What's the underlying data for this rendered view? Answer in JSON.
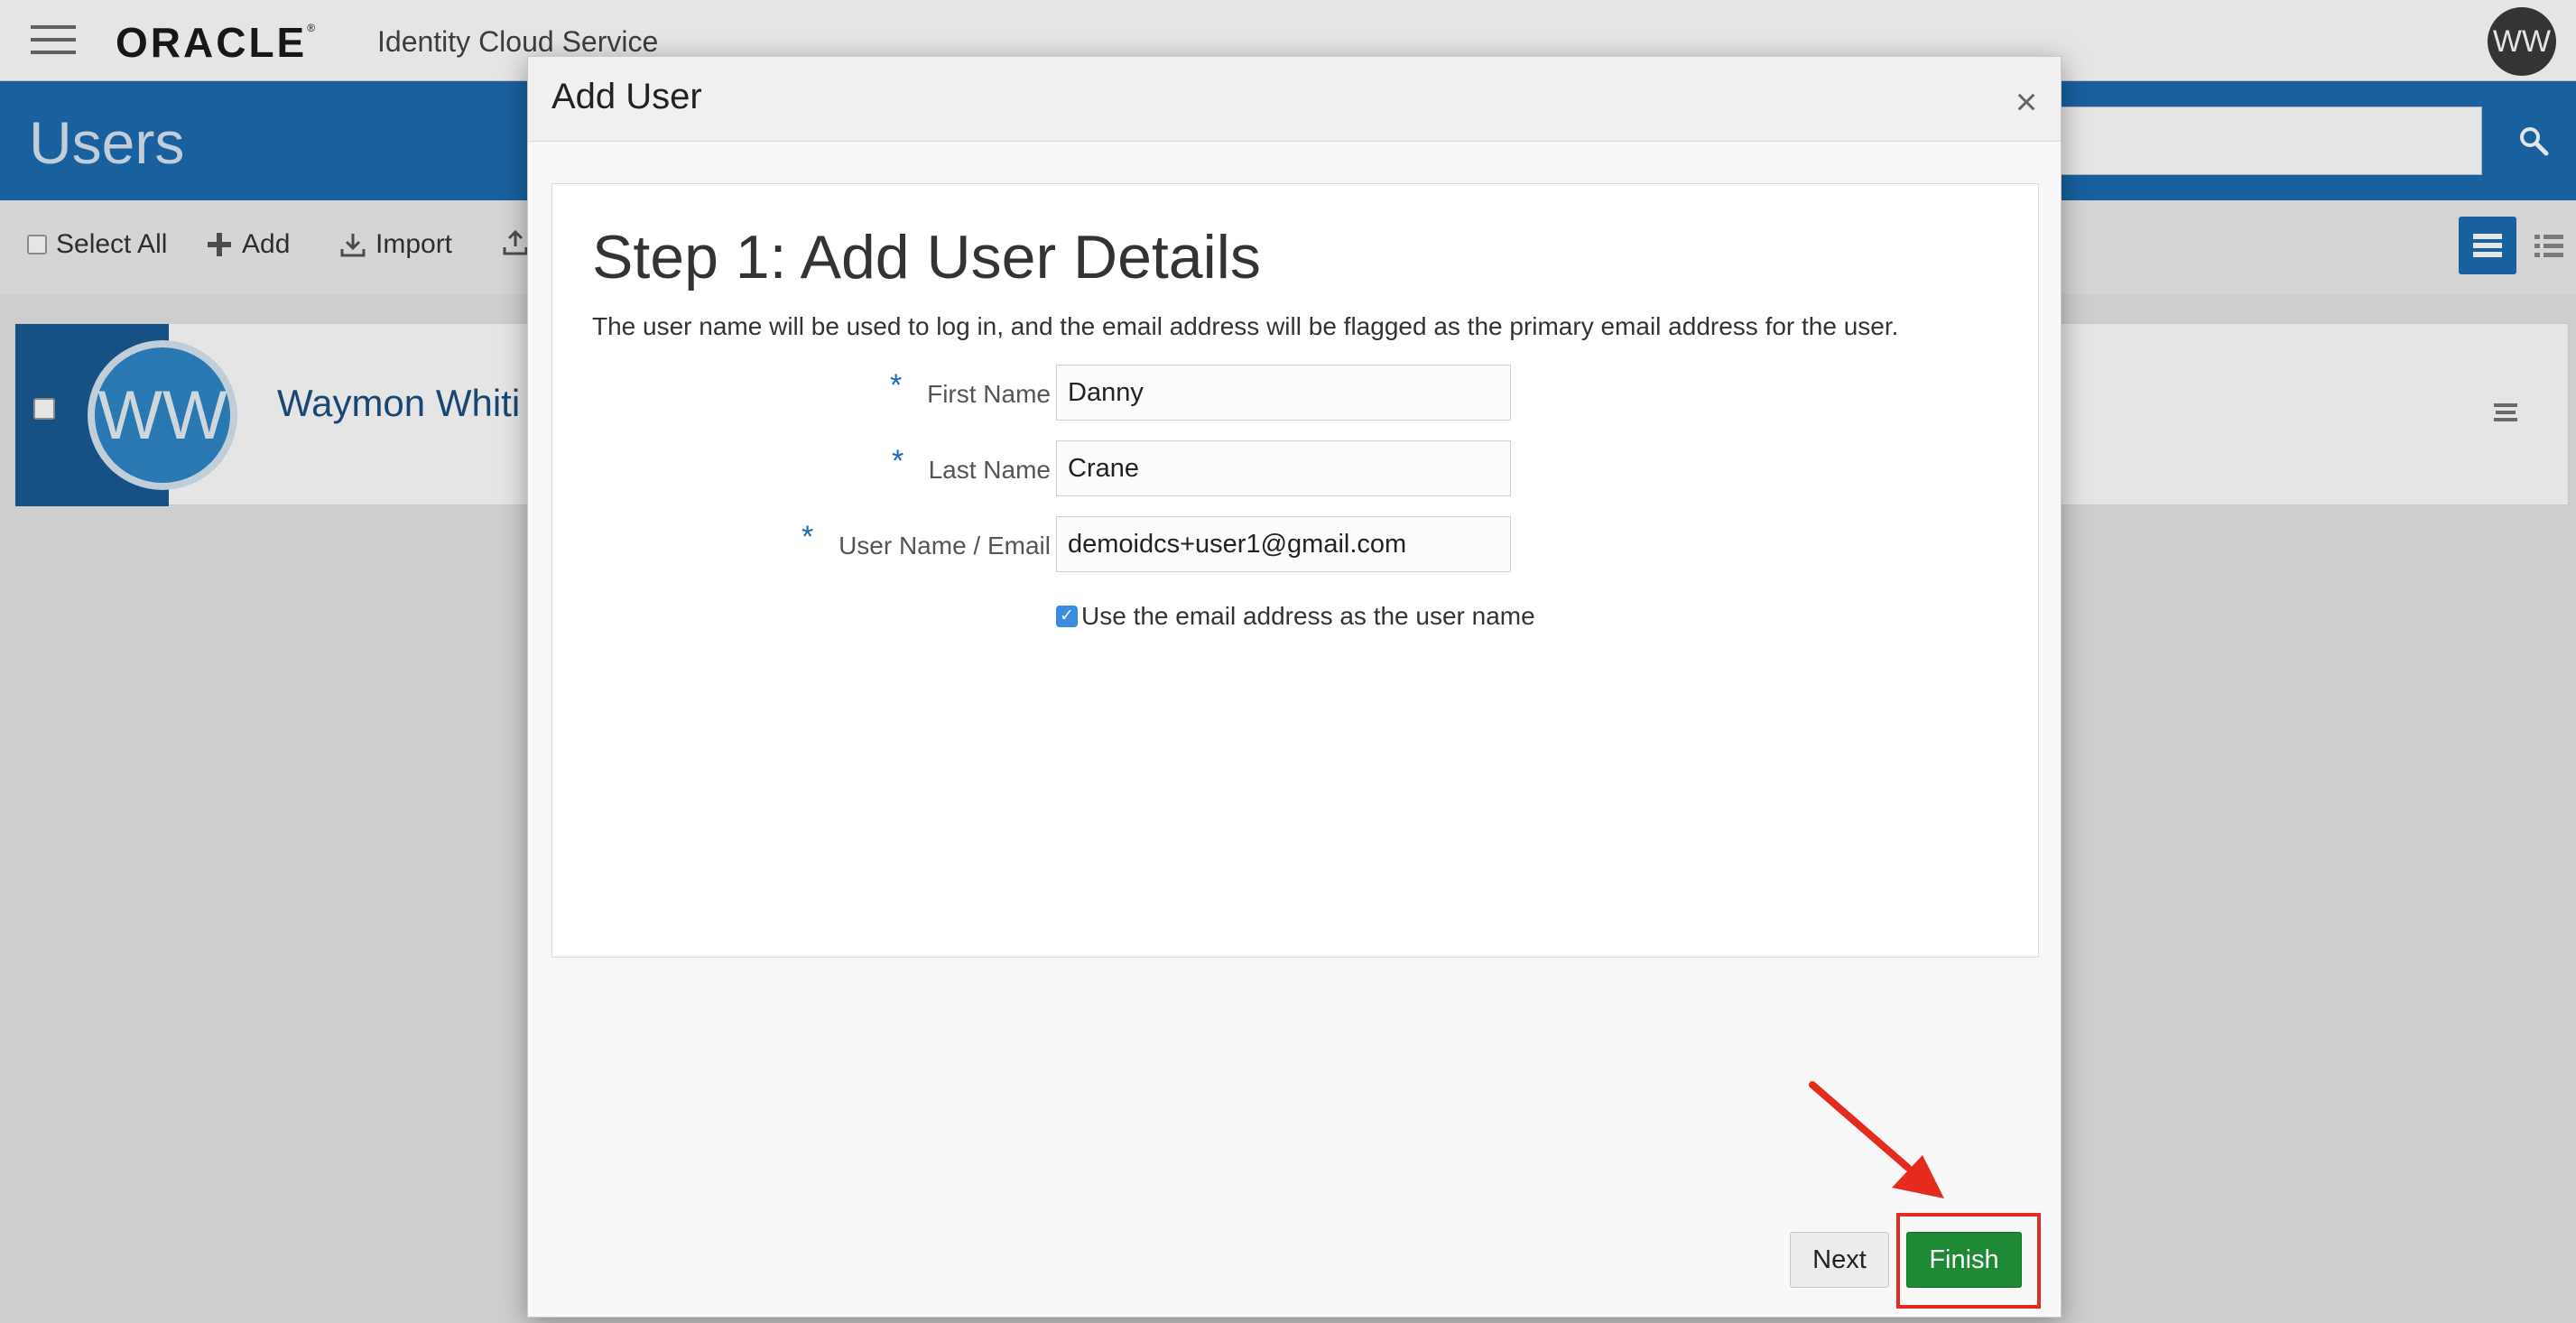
{
  "topbar": {
    "brand": "ORACLE",
    "brand_mark": "®",
    "product": "Identity Cloud Service",
    "avatar_initials": "WW"
  },
  "page": {
    "title": "Users"
  },
  "toolbar": {
    "select_all": "Select All",
    "add": "Add",
    "import": "Import"
  },
  "user_card": {
    "initials": "WW",
    "name_visible": "Waymon Whiti"
  },
  "modal": {
    "title": "Add User",
    "close": "×",
    "step_title": "Step 1: Add User Details",
    "description": "The user name will be used to log in, and the email address will be flagged as the primary email address for the user.",
    "fields": {
      "first_name": {
        "label": "First Name",
        "value": "Danny",
        "required": "*"
      },
      "last_name": {
        "label": "Last Name",
        "value": "Crane",
        "required": "*"
      },
      "user_name_email": {
        "label": "User Name / Email",
        "value": "demoidcs+user1@gmail.com",
        "required": "*"
      }
    },
    "use_email_checkbox": {
      "label": "Use the email address as the user name",
      "checked": true
    },
    "buttons": {
      "next": "Next",
      "finish": "Finish"
    }
  },
  "annotation": {
    "color": "#e52b1e",
    "icon": "red-arrow-icon"
  },
  "colors": {
    "brand_blue": "#1c6bb0",
    "finish_green": "#1e8a35",
    "highlight_red": "#e52b1e"
  }
}
